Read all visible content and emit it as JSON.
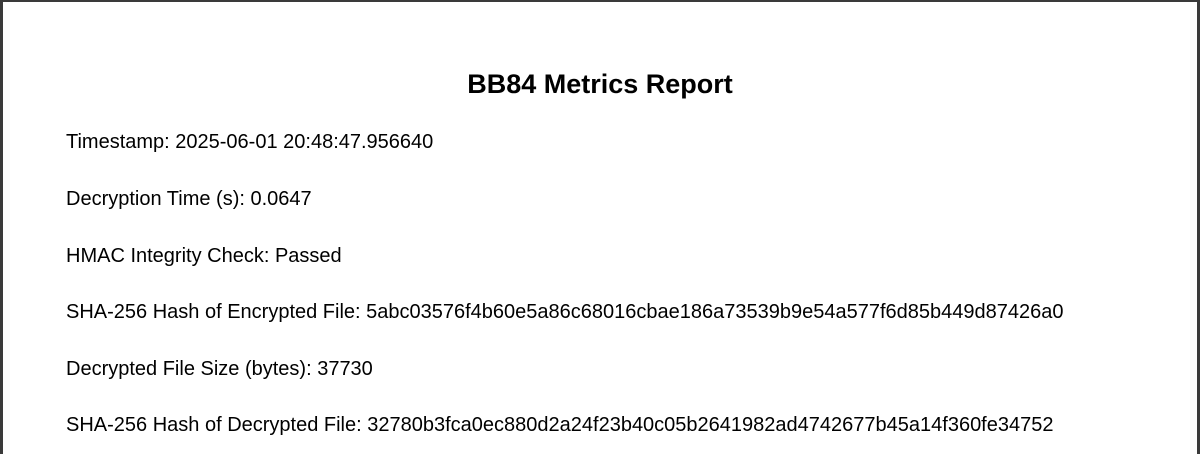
{
  "report": {
    "title": "BB84 Metrics Report",
    "lines": [
      "Timestamp: 2025-06-01 20:48:47.956640",
      "Decryption Time (s): 0.0647",
      "HMAC Integrity Check: Passed",
      "SHA-256 Hash of Encrypted File: 5abc03576f4b60e5a86c68016cbae186a73539b9e54a577f6d85b449d87426a0",
      "Decrypted File Size (bytes): 37730",
      "SHA-256 Hash of Decrypted File: 32780b3fca0ec880d2a24f23b40c05b2641982ad4742677b45a14f360fe34752"
    ]
  }
}
